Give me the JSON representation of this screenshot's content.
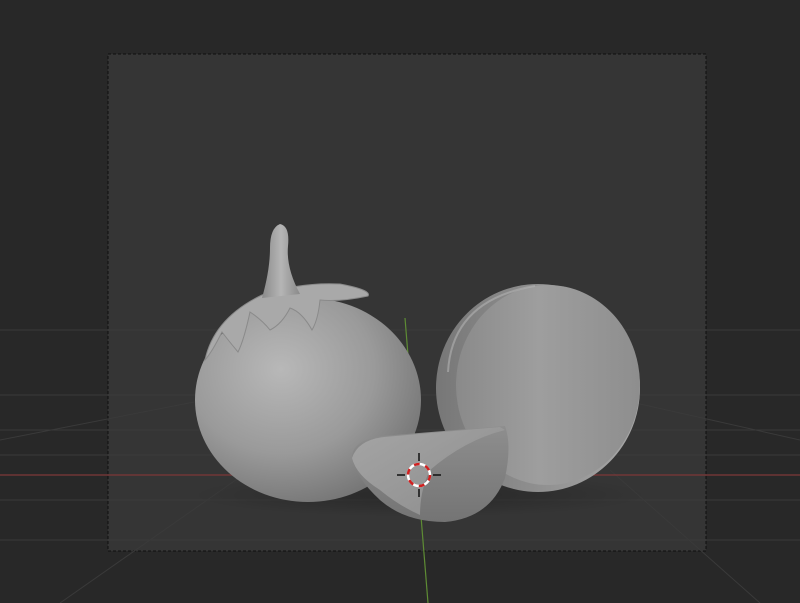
{
  "viewport": {
    "kind": "3d-viewport",
    "view": "camera-perspective",
    "shading": "solid",
    "background_color": "#282828",
    "camera_frame_color": "#353535",
    "axis_x_color": "#8c3a3a",
    "axis_y_color": "#6a9a3a",
    "mesh_color": "#9a9a9a"
  },
  "scene": {
    "objects": [
      {
        "name": "eggplant",
        "icon": "eggplant-mesh"
      },
      {
        "name": "slice-wedge",
        "icon": "wedge-mesh"
      },
      {
        "name": "slice-disc",
        "icon": "disc-mesh"
      }
    ],
    "cursor": {
      "icon": "3d-cursor-icon"
    }
  }
}
